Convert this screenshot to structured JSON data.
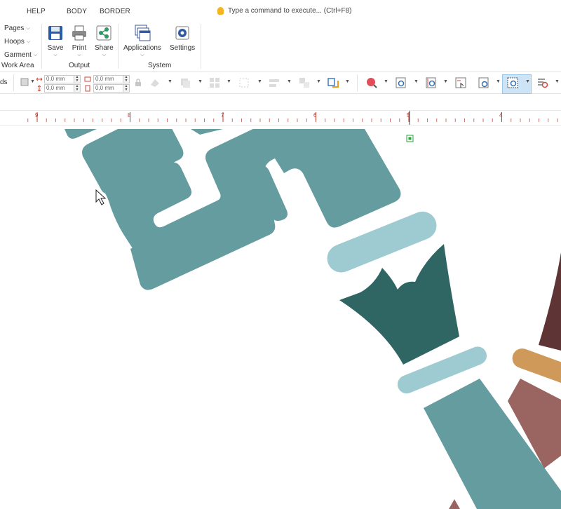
{
  "menu": {
    "tabs": [
      "HELP",
      "BODY",
      "BORDER"
    ],
    "command_placeholder": "Type a command to execute... (Ctrl+F8)"
  },
  "ribbon": {
    "work_area": {
      "items": [
        "Pages",
        "Hoops",
        "Garment"
      ],
      "label": "Work Area"
    },
    "output": {
      "buttons": [
        "Save",
        "Print",
        "Share"
      ],
      "label": "Output"
    },
    "system": {
      "buttons": [
        "Applications",
        "Settings"
      ],
      "label": "System"
    }
  },
  "toolbar": {
    "left_fragment": "ds",
    "width_value": "0,0 mm",
    "height_value": "0,0 mm",
    "pos_x_value": "0,0 mm",
    "pos_y_value": "0,0 mm"
  },
  "ruler": {
    "numbers": [
      "9",
      "8",
      "7",
      "6",
      "5",
      "4"
    ]
  },
  "colors": {
    "teal": "#659c9f",
    "light_blue": "#9ecad1",
    "dark_teal": "#2f6663",
    "brown": "#5e3434",
    "orange": "#cf9a59",
    "mauve": "#9a6461",
    "ruler_red": "#c0392b",
    "active_blue": "#cde4f7"
  }
}
